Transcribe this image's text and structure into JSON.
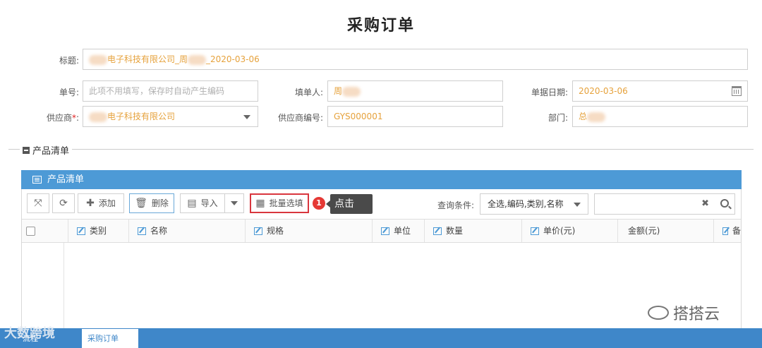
{
  "page_title": "采购订单",
  "form": {
    "title_label": "标题:",
    "title_value": "电子科技有限公司_周",
    "title_date": "_2020-03-06",
    "order_no_label": "单号:",
    "order_no_placeholder": "此项不用填写，保存时自动产生编码",
    "filler_label": "填单人:",
    "filler_value": "周",
    "date_label": "单据日期:",
    "date_value": "2020-03-06",
    "supplier_label": "供应商",
    "supplier_required": "*",
    "supplier_colon": ":",
    "supplier_value": "电子科技有限公司",
    "supplier_no_label": "供应商编号:",
    "supplier_no_value": "GYS000001",
    "dept_label": "部门:",
    "dept_value": "总"
  },
  "section": {
    "legend": "产品清单"
  },
  "panel": {
    "title": "产品清单"
  },
  "toolbar": {
    "add": "添加",
    "delete": "删除",
    "import": "导入",
    "batch": "批量选填",
    "badge": "1",
    "tooltip": "点击",
    "query_label": "查询条件:",
    "query_select": "全选,编码,类别,名称",
    "clear_symbol": "✖"
  },
  "columns": [
    "类别",
    "名称",
    "规格",
    "单位",
    "数量",
    "单价(元)",
    "金额(元)",
    "备"
  ],
  "watermark": {
    "brand": "搭搭云",
    "overlay": "大数跨境"
  },
  "taskbar": {
    "tab1": "流程",
    "tab2": "采购订单"
  },
  "colors": {
    "accent": "#4d9ad6",
    "taskbar": "#3f87c9",
    "value_text": "#e6a23c",
    "highlight": "#d9363e"
  }
}
